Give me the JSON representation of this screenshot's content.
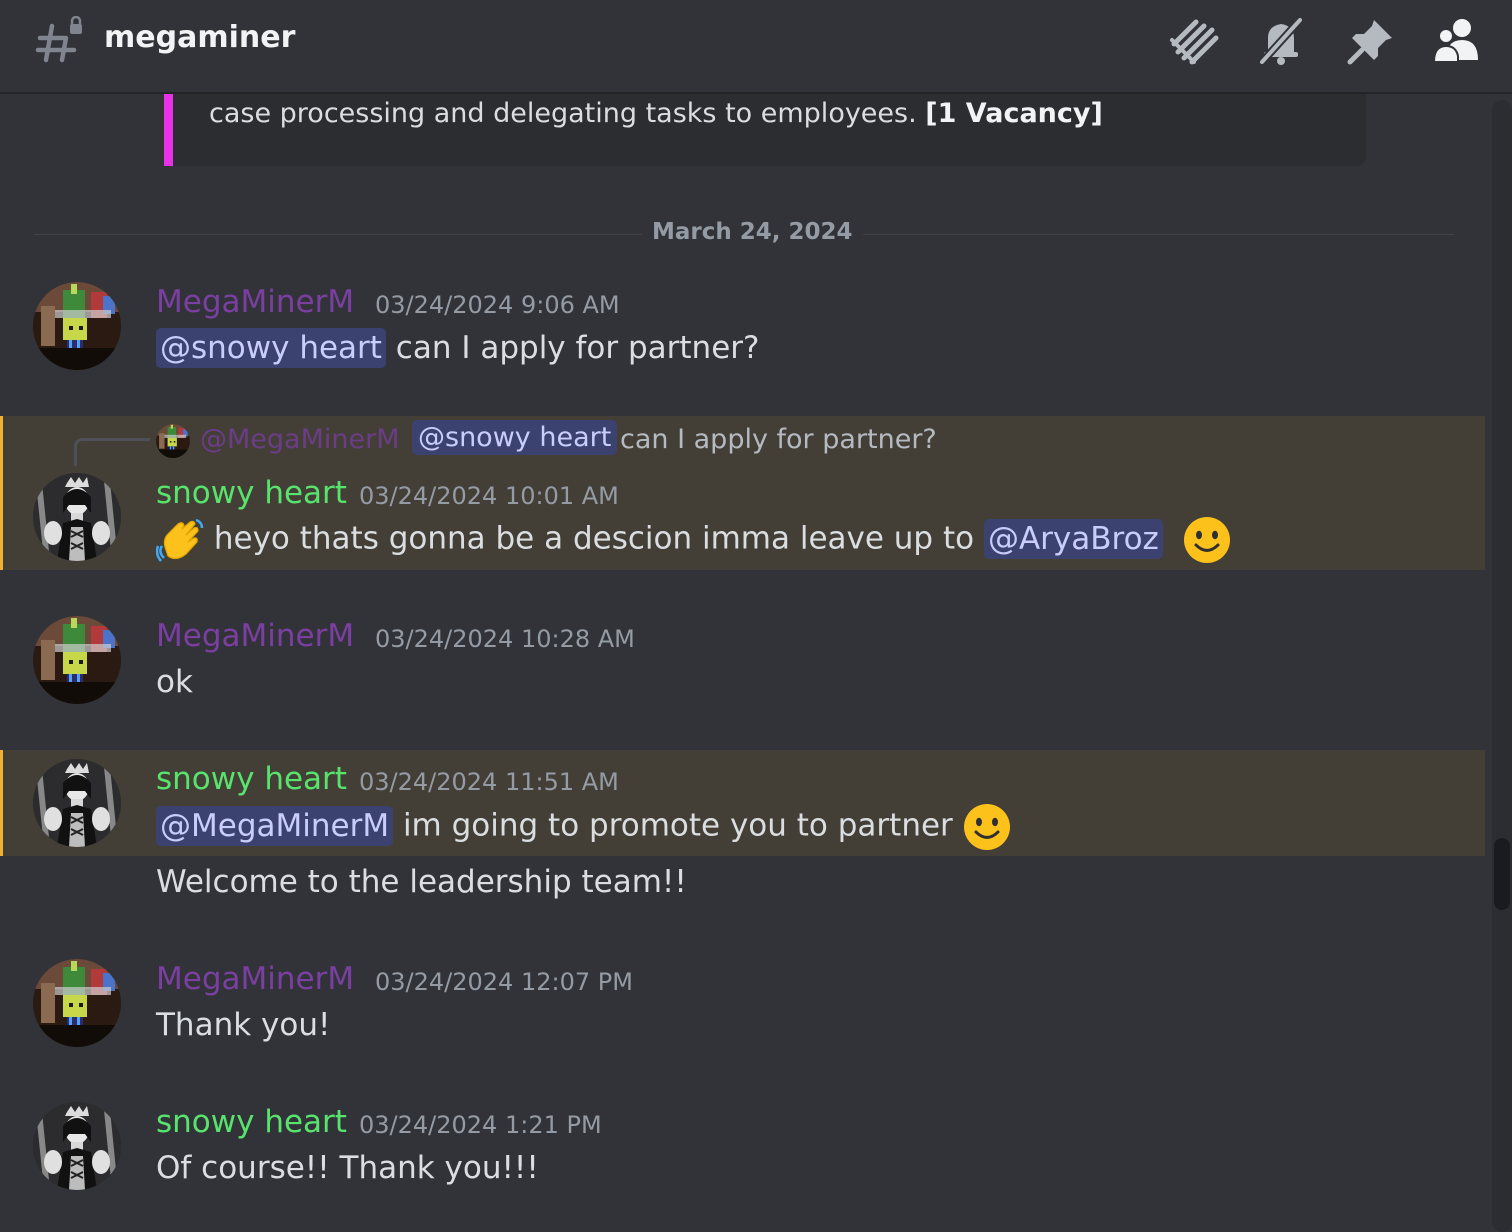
{
  "channel": {
    "name": "megaminer",
    "icon": "channel-hash-icon"
  },
  "header_icons": [
    "threads-icon",
    "mute-bell-icon",
    "pin-icon",
    "member-list-icon"
  ],
  "embed": {
    "text": "case processing and delegating tasks to employees.",
    "bold": "[1 Vacancy]",
    "accent_color": "#e832e8"
  },
  "date_divider": "March 24, 2024",
  "colors": {
    "mega": "#7a3fa0",
    "snowy": "#58e36d",
    "highlight": "#433f37",
    "highlight_border": "#f0b232"
  },
  "messages": [
    {
      "author": "MegaMinerM",
      "timestamp": "03/24/2024 9:06 AM",
      "mention": "@snowy heart",
      "text": "can I apply for partner?"
    },
    {
      "reply_to": {
        "author": "@MegaMinerM",
        "mention": "@snowy heart",
        "text": "can I apply for partner?"
      },
      "author": "snowy heart",
      "timestamp": "03/24/2024 10:01 AM",
      "emoji_before": "wave-emoji",
      "text": "heyo thats gonna be a descion imma leave up to",
      "mention": "@AryaBroz",
      "emoji_after": "slight-smile-emoji"
    },
    {
      "author": "MegaMinerM",
      "timestamp": "03/24/2024 10:28 AM",
      "text": "ok"
    },
    {
      "author": "snowy heart",
      "timestamp": "03/24/2024 11:51 AM",
      "mention": "@MegaMinerM",
      "text": "im going to promote you to partner",
      "emoji_after": "slight-smile-emoji",
      "continuation": "Welcome to the leadership team!!"
    },
    {
      "author": "MegaMinerM",
      "timestamp": "03/24/2024 12:07 PM",
      "text": "Thank you!"
    },
    {
      "author": "snowy heart",
      "timestamp": "03/24/2024 1:21 PM",
      "text": "Of course!! Thank you!!!"
    }
  ]
}
